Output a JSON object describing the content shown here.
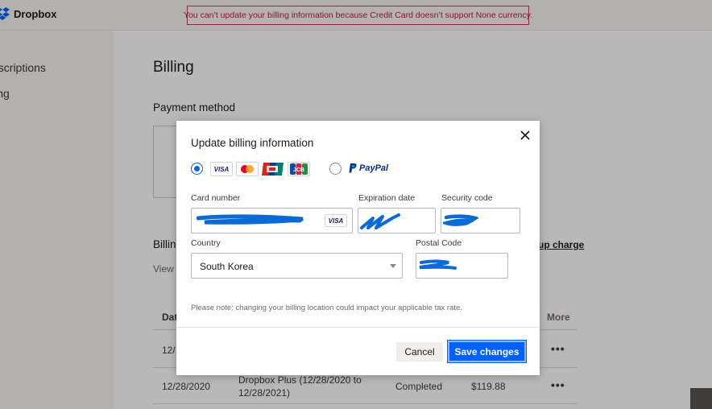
{
  "app": {
    "name": "Dropbox",
    "error_banner": "You can’t update your billing information because Credit Card doesn’t support None currency."
  },
  "sidebar": {
    "items": [
      {
        "label": "Subscriptions",
        "visible_text": "bscriptions"
      },
      {
        "label": "Billing",
        "visible_text": "ling"
      }
    ]
  },
  "page": {
    "title": "Billing",
    "payment_method_title": "Payment method",
    "billing_history_title": "Billing",
    "view_link": "View",
    "topup_link": "up charge",
    "table": {
      "headers": {
        "date": "Dat",
        "more": "More"
      },
      "rows": [
        {
          "date": "12/",
          "description": "",
          "status": "",
          "amount": ""
        },
        {
          "date": "12/28/2020",
          "description_line1": "Dropbox Plus (12/28/2020 to",
          "description_line2": "12/28/2021)",
          "status": "Completed",
          "amount": "$119.88"
        }
      ],
      "row_action_glyph": "•••"
    }
  },
  "modal": {
    "title": "Update billing information",
    "payment_options": {
      "card_selected": true,
      "card_brands": [
        "VISA",
        "mastercard",
        "unionpay",
        "JCB"
      ],
      "paypal_label": "PayPal"
    },
    "fields": {
      "card_number_label": "Card number",
      "card_number_brand": "VISA",
      "expiration_label": "Expiration date",
      "security_label": "Security code",
      "country_label": "Country",
      "country_value": "South Korea",
      "postal_label": "Postal Code"
    },
    "note": "Please note: changing your billing location could impact your applicable tax rate.",
    "buttons": {
      "cancel": "Cancel",
      "save": "Save changes"
    }
  },
  "colors": {
    "accent": "#0061fe",
    "error": "#c83a58",
    "redaction": "#0b6ad4"
  }
}
